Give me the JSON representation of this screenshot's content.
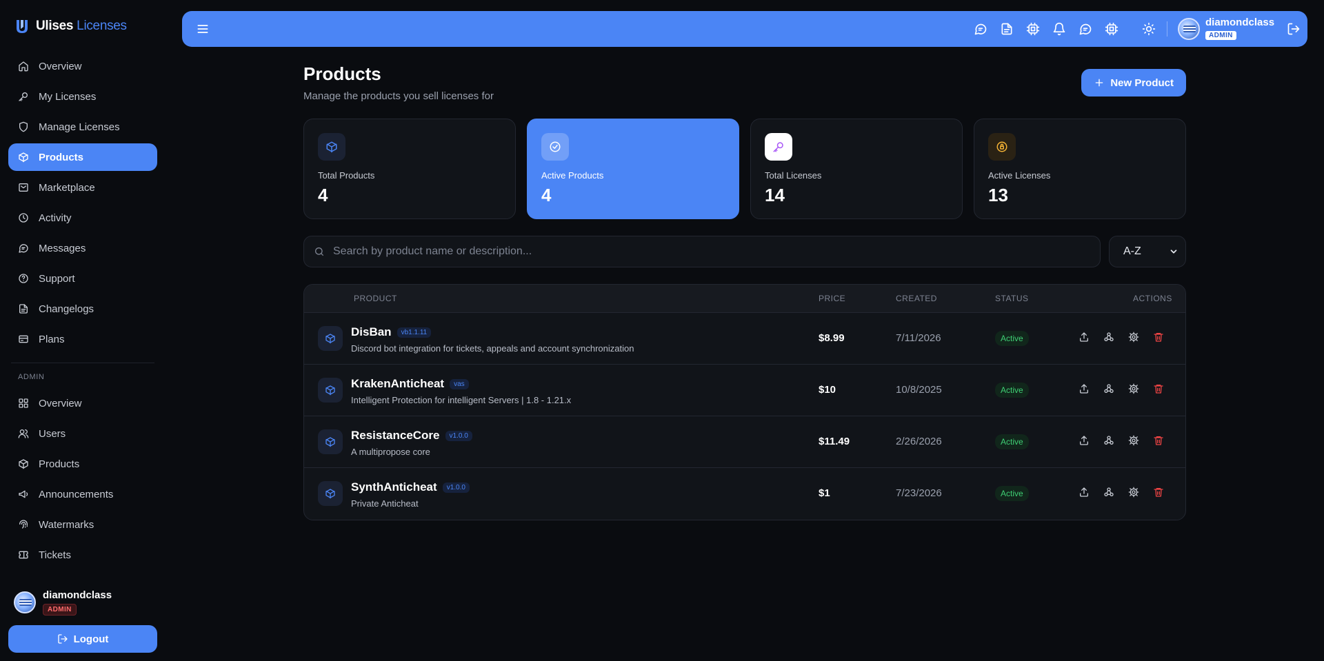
{
  "brand": {
    "name_part1": "Ulises",
    "name_part2": "Licenses"
  },
  "sidebar": {
    "items": [
      {
        "label": "Overview",
        "icon": "home-icon"
      },
      {
        "label": "My Licenses",
        "icon": "key-icon"
      },
      {
        "label": "Manage Licenses",
        "icon": "shield-icon"
      },
      {
        "label": "Products",
        "icon": "box-icon",
        "active": true
      },
      {
        "label": "Marketplace",
        "icon": "store-icon"
      },
      {
        "label": "Activity",
        "icon": "clock-icon"
      },
      {
        "label": "Messages",
        "icon": "message-icon"
      },
      {
        "label": "Support",
        "icon": "help-icon"
      },
      {
        "label": "Changelogs",
        "icon": "file-icon"
      },
      {
        "label": "Plans",
        "icon": "card-icon"
      }
    ],
    "admin_section": "ADMIN",
    "admin_items": [
      {
        "label": "Overview",
        "icon": "grid-icon"
      },
      {
        "label": "Users",
        "icon": "users-icon"
      },
      {
        "label": "Products",
        "icon": "box-icon"
      },
      {
        "label": "Announcements",
        "icon": "megaphone-icon"
      },
      {
        "label": "Watermarks",
        "icon": "fingerprint-icon"
      },
      {
        "label": "Tickets",
        "icon": "ticket-icon"
      }
    ],
    "user": {
      "name": "diamondclass",
      "role": "ADMIN"
    },
    "logout_label": "Logout"
  },
  "topbar": {
    "user": {
      "name": "diamondclass",
      "role": "ADMIN"
    }
  },
  "main": {
    "title": "Products",
    "subtitle": "Manage the products you sell licenses for",
    "new_button": "New Product",
    "stats": [
      {
        "label": "Total Products",
        "value": "4"
      },
      {
        "label": "Active Products",
        "value": "4"
      },
      {
        "label": "Total Licenses",
        "value": "14"
      },
      {
        "label": "Active Licenses",
        "value": "13"
      }
    ],
    "search": {
      "placeholder": "Search by product name or description..."
    },
    "sort": {
      "selected": "A-Z"
    },
    "table": {
      "headers": {
        "product": "PRODUCT",
        "price": "PRICE",
        "created": "CREATED",
        "status": "STATUS",
        "actions": "ACTIONS"
      },
      "rows": [
        {
          "name": "DisBan",
          "version": "vb1.1.11",
          "desc": "Discord bot integration for tickets, appeals and account synchronization",
          "price": "$8.99",
          "created": "7/11/2026",
          "status": "Active"
        },
        {
          "name": "KrakenAnticheat",
          "version": "vas",
          "desc": "Intelligent Protection for intelligent Servers | 1.8 - 1.21.x",
          "price": "$10",
          "created": "10/8/2025",
          "status": "Active"
        },
        {
          "name": "ResistanceCore",
          "version": "v1.0.0",
          "desc": "A multipropose core",
          "price": "$11.49",
          "created": "2/26/2026",
          "status": "Active"
        },
        {
          "name": "SynthAnticheat",
          "version": "v1.0.0",
          "desc": "Private Anticheat",
          "price": "$1",
          "created": "7/23/2026",
          "status": "Active"
        }
      ]
    }
  },
  "colors": {
    "accent": "#4b85f5",
    "background": "#0a0c10",
    "card": "#111419",
    "status_green": "#3fcf74",
    "danger": "#ef4444"
  }
}
